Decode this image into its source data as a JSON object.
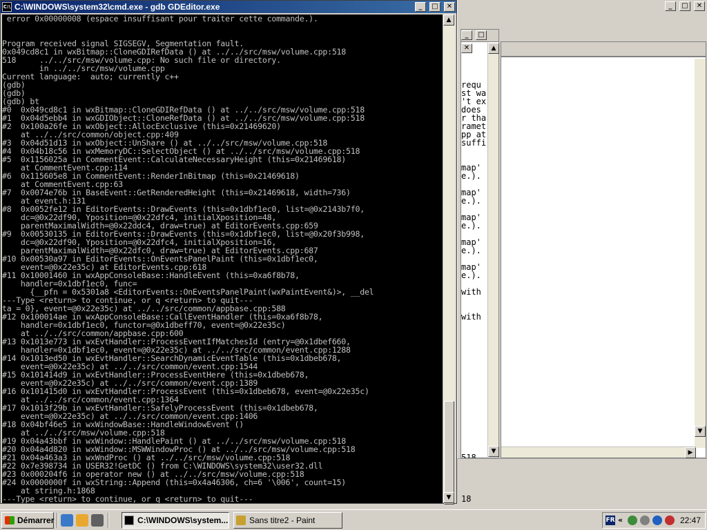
{
  "background_window": {
    "side_text": [
      "requ",
      "st wa",
      "'t ex",
      "does",
      "r tha",
      "ramet",
      "pp at",
      "suffi",
      "",
      "",
      "map'",
      "e.).",
      "",
      "map'",
      "e.).",
      "",
      "map'",
      "e.).",
      "",
      "map'",
      "e.).",
      "",
      "map'",
      "e.).",
      "",
      "with",
      "",
      "",
      "with",
      "",
      "",
      "",
      "",
      "",
      "",
      "",
      "",
      "",
      "",
      "",
      "",
      "",
      "",
      "",
      "",
      "518",
      "518",
      "",
      "",
      "",
      "18"
    ]
  },
  "cmd": {
    "title": "C:\\WINDOWS\\system32\\cmd.exe - gdb GDEditor.exe",
    "icon_label": "C:\\",
    "lines": [
      " error 0x00000008 (espace insuffisant pour traiter cette commande.).",
      "",
      "",
      "Program received signal SIGSEGV, Segmentation fault.",
      "0x049cd8c1 in wxBitmap::CloneGDIRefData () at ../../src/msw/volume.cpp:518",
      "518     ../../src/msw/volume.cpp: No such file or directory.",
      "        in ../../src/msw/volume.cpp",
      "Current language:  auto; currently c++",
      "(gdb)",
      "(gdb)",
      "(gdb) bt",
      "#0  0x049cd8c1 in wxBitmap::CloneGDIRefData () at ../../src/msw/volume.cpp:518",
      "#1  0x04d5ebb4 in wxGDIObject::CloneRefData () at ../../src/msw/volume.cpp:518",
      "#2  0x100a26fe in wxObject::AllocExclusive (this=0x21469620)",
      "    at ../../src/common/object.cpp:409",
      "#3  0x04d51d13 in wxObject::UnShare () at ../../src/msw/volume.cpp:518",
      "#4  0x04b18c56 in wxMemoryDC::SelectObject () at ../../src/msw/volume.cpp:518",
      "#5  0x1156025a in CommentEvent::CalculateNecessaryHeight (this=0x21469618)",
      "    at CommentEvent.cpp:114",
      "#6  0x115605e8 in CommentEvent::RenderInBitmap (this=0x21469618)",
      "    at CommentEvent.cpp:63",
      "#7  0x0074e76b in BaseEvent::GetRenderedHeight (this=0x21469618, width=736)",
      "    at event.h:131",
      "#8  0x0052fe12 in EditorEvents::DrawEvents (this=0x1dbf1ec0, list=@0x2143b7f0,",
      "    dc=@0x22df90, Yposition=@0x22dfc4, initialXposition=48,",
      "    parentMaximalWidth=@0x22ddc4, draw=true) at EditorEvents.cpp:659",
      "#9  0x00530135 in EditorEvents::DrawEvents (this=0x1dbf1ec0, list=@0x20f3b998,",
      "    dc=@0x22df90, Yposition=@0x22dfc4, initialXposition=16,",
      "    parentMaximalWidth=@0x22dfc0, draw=true) at EditorEvents.cpp:687",
      "#10 0x00530a97 in EditorEvents::OnEventsPanelPaint (this=0x1dbf1ec0,",
      "    event=@0x22e35c) at EditorEvents.cpp:618",
      "#11 0x10001460 in wxAppConsoleBase::HandleEvent (this=0xa6f8b78,",
      "    handler=0x1dbf1ec0, func=",
      "      {__pfn = 0x5301a8 <EditorEvents::OnEventsPanelPaint(wxPaintEvent&)>, __del",
      "---Type <return> to continue, or q <return> to quit---",
      "ta = 0}, event=@0x22e35c) at ../../src/common/appbase.cpp:588",
      "#12 0x100014ae in wxAppConsoleBase::CallEventHandler (this=0xa6f8b78,",
      "    handler=0x1dbf1ec0, functor=@0x1dbeff70, event=@0x22e35c)",
      "    at ../../src/common/appbase.cpp:600",
      "#13 0x1013e773 in wxEvtHandler::ProcessEventIfMatchesId (entry=@0x1dbef660,",
      "    handler=0x1dbf1ec0, event=@0x22e35c) at ../../src/common/event.cpp:1288",
      "#14 0x1013ed50 in wxEvtHandler::SearchDynamicEventTable (this=0x1dbeb678,",
      "    event=@0x22e35c) at ../../src/common/event.cpp:1544",
      "#15 0x101414d9 in wxEvtHandler::ProcessEventHere (this=0x1dbeb678,",
      "    event=@0x22e35c) at ../../src/common/event.cpp:1389",
      "#16 0x101415d0 in wxEvtHandler::ProcessEvent (this=0x1dbeb678, event=@0x22e35c)",
      "    at ../../src/common/event.cpp:1364",
      "#17 0x1013f29b in wxEvtHandler::SafelyProcessEvent (this=0x1dbeb678,",
      "    event=@0x22e35c) at ../../src/common/event.cpp:1406",
      "#18 0x04bf46e5 in wxWindowBase::HandleWindowEvent ()",
      "    at ../../src/msw/volume.cpp:518",
      "#19 0x04a43bbf in wxWindow::HandlePaint () at ../../src/msw/volume.cpp:518",
      "#20 0x04a4d820 in wxWindow::MSWWindowProc () at ../../src/msw/volume.cpp:518",
      "#21 0x04a463a3 in wxWndProc () at ../../src/msw/volume.cpp:518",
      "#22 0x7e398734 in USER32!GetDC () from C:\\WINDOWS\\system32\\user32.dll",
      "#23 0x000204f6 in operator new () at ../../src/msw/volume.cpp:518",
      "#24 0x0000000f in wxString::Append (this=0x4a46306, ch=6 '\\006', count=15)",
      "    at string.h:1868",
      "---Type <return> to continue, or q <return> to quit---"
    ]
  },
  "taskbar": {
    "start_label": "Démarrer",
    "tasks": [
      {
        "label": "C:\\WINDOWS\\system...",
        "active": true
      },
      {
        "label": "Sans titre2 - Paint",
        "active": false
      }
    ],
    "lang": "FR",
    "chevron": "«",
    "clock": "22:47"
  },
  "colors": {
    "console_bg": "#000000",
    "console_text": "#c0c0c0",
    "titlebar_start": "#0a246a",
    "titlebar_end": "#3a6ea5",
    "face": "#d4d0c8"
  },
  "icons": {
    "minimize": "_",
    "maximize": "□",
    "close": "✕",
    "up": "▲",
    "down": "▼",
    "left": "◀",
    "right": "▶"
  }
}
